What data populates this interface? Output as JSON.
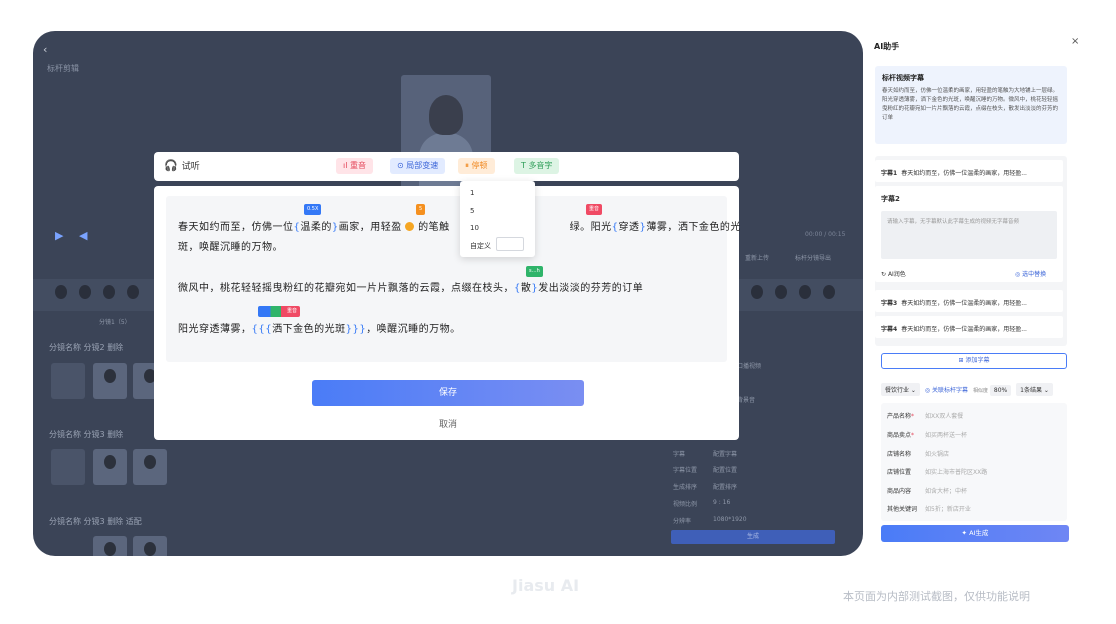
{
  "background": {
    "title": "标杆剪辑",
    "timecode": "00:00 / 00:15",
    "reupload": "重新上传",
    "pair_import": "标杆分镜导出",
    "clip_label": "分镜1（5）",
    "groups": [
      {
        "label": "分镜名称",
        "value": "分镜2",
        "extra": "删除"
      },
      {
        "label": "分镜名称",
        "value": "分镜3",
        "extra": "删除"
      },
      {
        "label": "分镜名称",
        "value": "分镜3",
        "extra": "删除",
        "extra2": "适配"
      }
    ],
    "side_fields": [
      {
        "k": "字幕",
        "v": "配置字幕"
      },
      {
        "k": "字幕位置",
        "v": "配置位置"
      },
      {
        "k": "生成排序",
        "v": "配置排序"
      },
      {
        "k": "视频比例",
        "v": "9 : 16"
      },
      {
        "k": "分辨率",
        "v": "1080*1920"
      }
    ],
    "side_header": "口播视频",
    "side_music": "背景音",
    "generate": "生成"
  },
  "toolbar": {
    "listen": "试听",
    "chips": {
      "reread": "重音",
      "speed": "局部变速",
      "pause": "停顿",
      "polyphone": "多音字"
    }
  },
  "dropdown": {
    "items": [
      "1",
      "5",
      "10"
    ],
    "custom_label": "自定义"
  },
  "editor": {
    "tags": {
      "speed": "0.5X",
      "pause": "5",
      "stress": "重音",
      "poly": "s…h",
      "combo": "重音"
    },
    "line1": {
      "a": "春天如约而至，仿佛一位",
      "b": "温柔的",
      "c": "画家，用轻盈",
      "d": "的笔触",
      "e": "绿。阳光",
      "f": "穿透",
      "g": "薄雾，洒下金色的光"
    },
    "line1b": "斑，唤醒沉睡的万物。",
    "line2": {
      "a": "微风中，桃花轻轻摇曳粉红的花瓣宛如一片片飘落的云霞，点缀在枝头，",
      "b": "散",
      "c": "发出淡淡的芬芳的订单"
    },
    "line3": {
      "a": "阳光穿透薄雾，",
      "b": "洒下金色的光斑",
      "c": "，唤醒沉睡的万物。"
    }
  },
  "modal": {
    "save": "保存",
    "cancel": "取消"
  },
  "panel": {
    "title": "AI助手",
    "close": "×",
    "ref_title": "标杆视频字幕",
    "ref_text": "春天如约而至，仿佛一位温柔的画家，用轻盈的笔触为大地铺上一层绿。阳光穿透薄雾，洒下金色的光斑，唤醒沉睡的万物。微风中，桃花轻轻摇曳粉红的花瓣宛如一片片飘落的云霞，点缀在枝头，散发出淡淡的芬芳的订单",
    "subs": [
      {
        "label": "字幕1",
        "text": "春天如约而至，仿佛一位温柔的画家，用轻盈..."
      },
      {
        "label": "字幕3",
        "text": "春天如约而至，仿佛一位温柔的画家，用轻盈..."
      },
      {
        "label": "字幕4",
        "text": "春天如约而至，仿佛一位温柔的画家，用轻盈..."
      }
    ],
    "sub2_title": "字幕2",
    "sub2_placeholder": "请输入字幕，无字幕默认此字幕生成的视频无字幕音频",
    "sub2_ai": "AI润色",
    "sub2_match": "选中替换",
    "add_sub": "添加字幕",
    "industry": "餐饮行业",
    "link_ref": "关联标杆字幕",
    "similarity_label": "相似度",
    "similarity": "80%",
    "result_count": "1条结果",
    "fields": [
      {
        "k": "产品名称",
        "req": true,
        "ph": "如XX双人套餐"
      },
      {
        "k": "商品卖点",
        "req": true,
        "ph": "如买两杯送一杯"
      },
      {
        "k": "店铺名称",
        "req": false,
        "ph": "如火锅店"
      },
      {
        "k": "店铺位置",
        "req": false,
        "ph": "如实上海市普陀区XX路"
      },
      {
        "k": "商品内容",
        "req": false,
        "ph": "如含大杯；中杯"
      },
      {
        "k": "其他关键词",
        "req": false,
        "ph": "如5折；新店开业"
      }
    ],
    "ai_generate": "AI生成"
  },
  "footer": {
    "brand": "Jiasu AI",
    "disclaimer": "本页面为内部测试截图，仅供功能说明"
  }
}
